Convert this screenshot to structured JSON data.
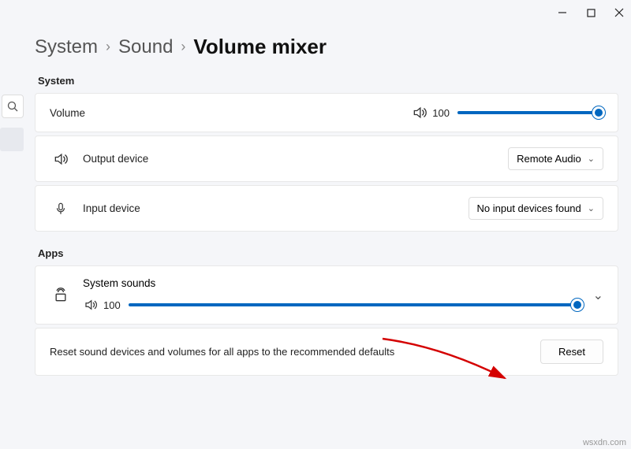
{
  "breadcrumb": {
    "system": "System",
    "sound": "Sound",
    "current": "Volume mixer"
  },
  "sections": {
    "system": "System",
    "apps": "Apps"
  },
  "volume": {
    "label": "Volume",
    "value": "100"
  },
  "output": {
    "label": "Output device",
    "selected": "Remote Audio"
  },
  "input": {
    "label": "Input device",
    "selected": "No input devices found"
  },
  "systemSounds": {
    "label": "System sounds",
    "value": "100"
  },
  "reset": {
    "text": "Reset sound devices and volumes for all apps to the recommended defaults",
    "button": "Reset"
  },
  "watermark": "wsxdn.com"
}
